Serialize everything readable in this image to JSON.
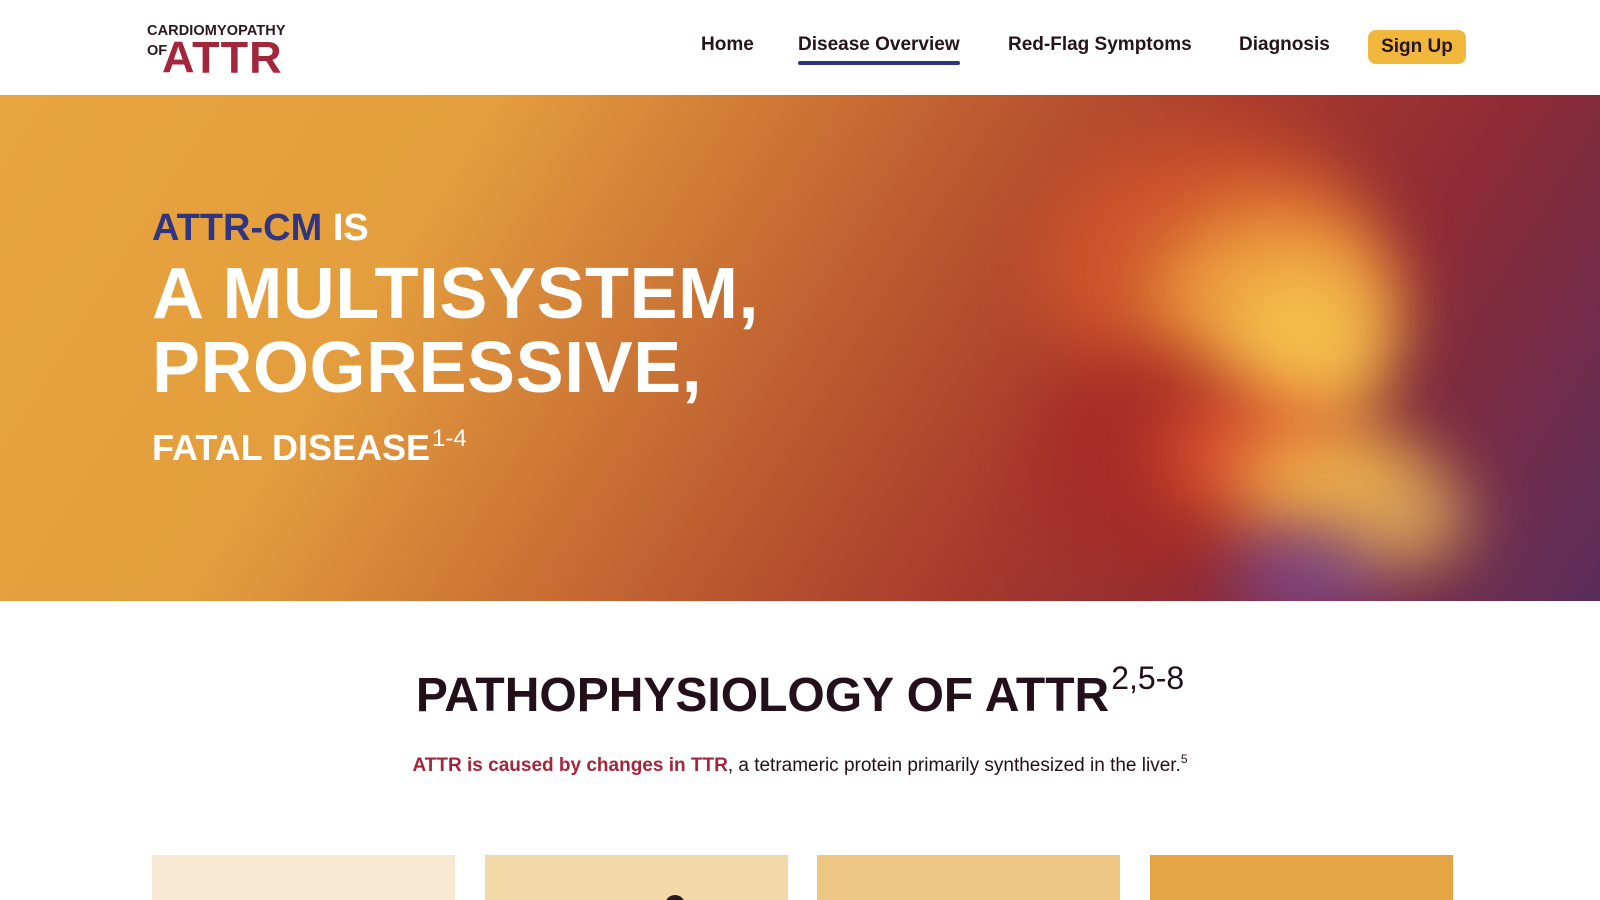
{
  "logo": {
    "top": "CARDIOMYOPATHY",
    "of": "OF",
    "main": "ATTR"
  },
  "nav": {
    "items": [
      {
        "label": "Home"
      },
      {
        "label": "Disease Overview"
      },
      {
        "label": "Red-Flag Symptoms"
      },
      {
        "label": "Diagnosis"
      }
    ],
    "active": "Disease Overview",
    "signup_label": "Sign Up"
  },
  "hero": {
    "line1_accent": "ATTR-CM",
    "line1_rest": "IS",
    "line2": "A MULTISYSTEM,",
    "line3": "PROGRESSIVE,",
    "line4": "FATAL DISEASE",
    "line4_ref": "1-4"
  },
  "section": {
    "title": "PATHOPHYSIOLOGY OF ATTR",
    "title_ref": "2,5-8",
    "sub_highlight": "ATTR is caused by changes in TTR",
    "sub_rest": ", a tetrameric protein primarily synthesized in the liver.",
    "sub_ref": "5"
  },
  "colors": {
    "brand_red": "#a3263b",
    "brand_navy": "#2f3580",
    "button_yellow": "#f1b73d",
    "text_dark": "#24101a"
  }
}
